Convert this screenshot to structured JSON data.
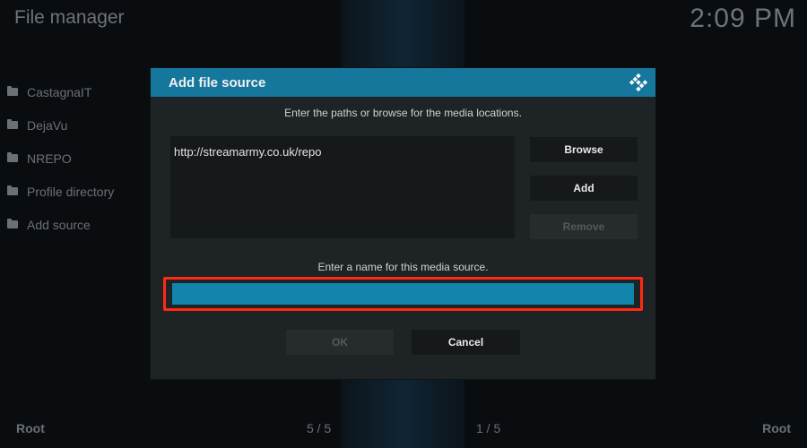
{
  "header": {
    "title": "File manager",
    "clock": "2:09 PM"
  },
  "sidebar": {
    "items": [
      {
        "label": "CastagnaIT"
      },
      {
        "label": "DejaVu"
      },
      {
        "label": "NREPO"
      },
      {
        "label": "Profile directory"
      },
      {
        "label": "Add source"
      }
    ]
  },
  "dialog": {
    "title": "Add file source",
    "instruction_paths": "Enter the paths or browse for the media locations.",
    "paths": [
      "http://streamarmy.co.uk/repo"
    ],
    "browse_label": "Browse",
    "add_label": "Add",
    "remove_label": "Remove",
    "instruction_name": "Enter a name for this media source.",
    "name_value": "",
    "ok_label": "OK",
    "cancel_label": "Cancel",
    "accent_color": "#15779b",
    "highlight_color": "#ff2a12"
  },
  "footer": {
    "left_label": "Root",
    "right_label": "Root",
    "page_left": "5 / 5",
    "page_right": "1 / 5"
  }
}
